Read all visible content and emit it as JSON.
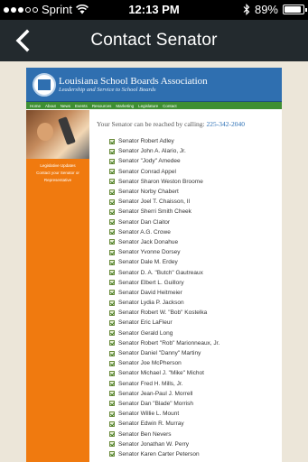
{
  "status_bar": {
    "carrier": "Sprint",
    "time": "12:13 PM",
    "battery": "89%",
    "battery_level": 0.89,
    "signal_bars": 5,
    "signal_filled": 3,
    "icons": [
      "wifi-icon",
      "bluetooth-icon",
      "battery-icon"
    ]
  },
  "nav": {
    "title": "Contact Senator",
    "back_icon": "chevron-left-icon"
  },
  "site": {
    "org_name": "Louisiana School Boards Association",
    "tagline": "Leadership and Service to School Boards",
    "menu": [
      "Home",
      "About",
      "News",
      "Events",
      "Resources",
      "Marketing",
      "Legislature",
      "Contact"
    ],
    "sidebar_links": [
      "Legislative Updates",
      "Contact your Senator or",
      "Representative"
    ],
    "call_text": "Your Senator can be reached by calling:",
    "phone": "225-342-2040",
    "colors": {
      "header": "#2f6fb0",
      "menu": "#3f8f33",
      "sidebar": "#f07a0f",
      "nav": "#232a2e"
    }
  },
  "senators": [
    "Senator Robert Adley",
    "Senator John A. Alario, Jr.",
    "Senator \"Jody\" Amedee",
    "Senator Conrad Appel",
    "Senator Sharon Weston Broome",
    "Senator Norby Chabert",
    "Senator Joel T. Chaisson, II",
    "Senator Sherri Smith Cheek",
    "Senator Dan Claitor",
    "Senator A.G. Crowe",
    "Senator Jack Donahue",
    "Senator Yvonne Dorsey",
    "Senator Dale M. Erdey",
    "Senator D. A. \"Butch\" Gautreaux",
    "Senator Elbert L. Guillory",
    "Senator David Heitmeier",
    "Senator Lydia P. Jackson",
    "Senator Robert W. \"Bob\" Kostelka",
    "Senator Eric LaFleur",
    "Senator Gerald Long",
    "Senator Robert \"Rob\" Marionneaux, Jr.",
    "Senator Daniel \"Danny\" Martiny",
    "Senator Joe McPherson",
    "Senator Michael J. \"Mike\" Michot",
    "Senator Fred H. Mills, Jr.",
    "Senator Jean-Paul J. Morrell",
    "Senator Dan \"Blade\" Morrish",
    "Senator Willie L. Mount",
    "Senator Edwin R. Murray",
    "Senator Ben Nevers",
    "Senator Jonathan W. Perry",
    "Senator Karen Carter Peterson"
  ]
}
